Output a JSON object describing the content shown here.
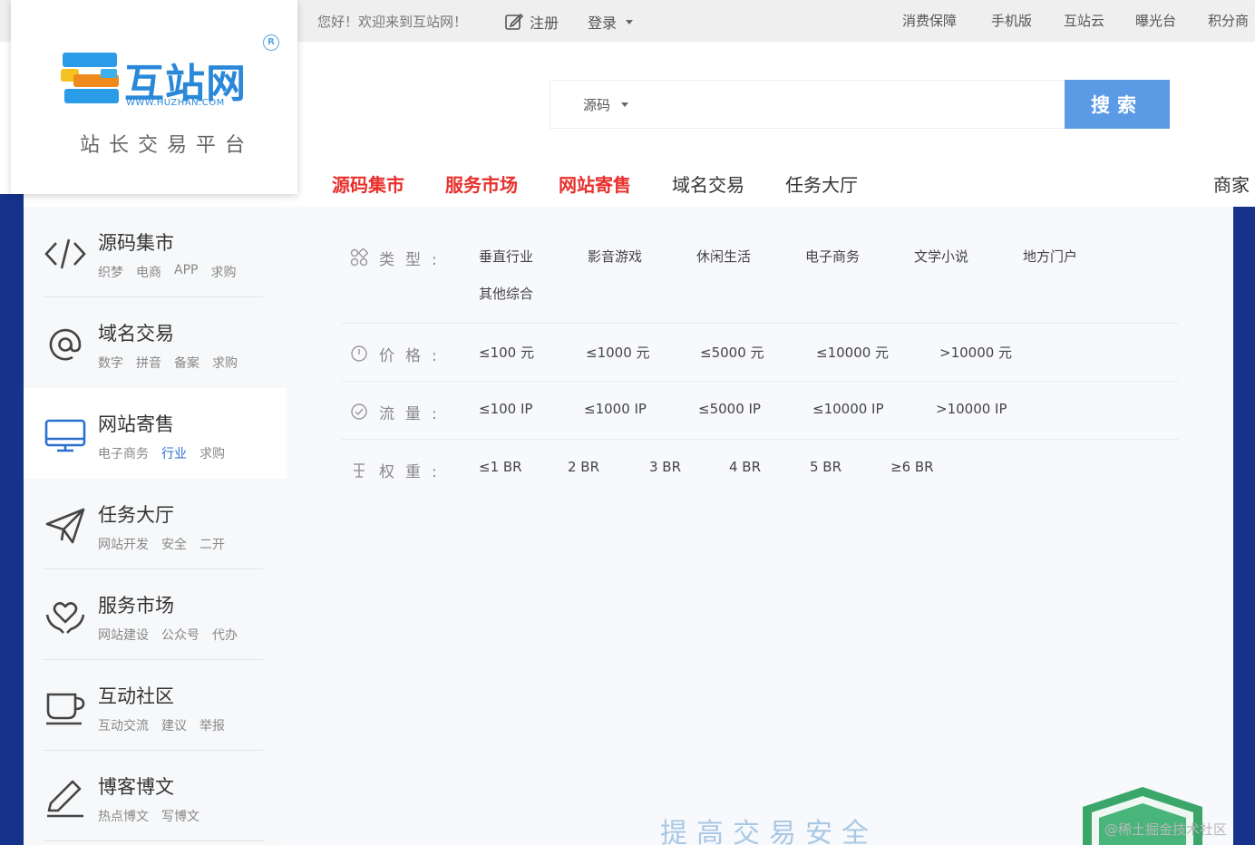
{
  "topbar": {
    "welcome": "您好！欢迎来到互站网！",
    "register": "注册",
    "login": "登录",
    "right_links": [
      "消费保障",
      "手机版",
      "互站云",
      "曝光台",
      "积分商"
    ]
  },
  "logo": {
    "name": "互站网",
    "url": "WWW.HUZHAN.COM",
    "slogan": "站长交易平台",
    "registered": "R"
  },
  "search": {
    "category": "源码",
    "placeholder": "",
    "button": "搜索"
  },
  "main_nav": {
    "items": [
      {
        "label": "源码集市",
        "hot": true
      },
      {
        "label": "服务市场",
        "hot": true
      },
      {
        "label": "网站寄售",
        "hot": true
      },
      {
        "label": "域名交易",
        "hot": false
      },
      {
        "label": "任务大厅",
        "hot": false
      }
    ],
    "merchant": "商家"
  },
  "sidebar": {
    "items": [
      {
        "title": "源码集市",
        "subs": [
          "织梦",
          "电商",
          "APP",
          "求购"
        ],
        "icon": "code-icon"
      },
      {
        "title": "域名交易",
        "subs": [
          "数字",
          "拼音",
          "备案",
          "求购"
        ],
        "icon": "at-icon"
      },
      {
        "title": "网站寄售",
        "subs": [
          "电子商务",
          "行业",
          "求购"
        ],
        "icon": "monitor-icon"
      },
      {
        "title": "任务大厅",
        "subs": [
          "网站开发",
          "安全",
          "二开"
        ],
        "icon": "paper-plane-icon"
      },
      {
        "title": "服务市场",
        "subs": [
          "网站建设",
          "公众号",
          "代办"
        ],
        "icon": "heart-hands-icon"
      },
      {
        "title": "互动社区",
        "subs": [
          "互动交流",
          "建议",
          "举报"
        ],
        "icon": "cup-icon"
      },
      {
        "title": "博客博文",
        "subs": [
          "热点博文",
          "写博文"
        ],
        "icon": "pen-icon"
      }
    ]
  },
  "filters": {
    "type": {
      "label": "类型:",
      "options": [
        "垂直行业",
        "影音游戏",
        "休闲生活",
        "电子商务",
        "文学小说",
        "地方门户",
        "其他综合"
      ]
    },
    "price": {
      "label": "价格:",
      "options": [
        "≤100 元",
        "≤1000 元",
        "≤5000 元",
        "≤10000 元",
        ">10000 元"
      ]
    },
    "traffic": {
      "label": "流量:",
      "options": [
        "≤100 IP",
        "≤1000 IP",
        "≤5000 IP",
        "≤10000 IP",
        ">10000 IP"
      ]
    },
    "weight": {
      "label": "权重:",
      "options": [
        "≤1 BR",
        "2 BR",
        "3 BR",
        "4 BR",
        "5 BR",
        "≥6 BR"
      ]
    }
  },
  "footer": {
    "slogan": "提高交易安全",
    "watermark": "@稀土掘金技术社区"
  },
  "colors": {
    "accent_red": "#e8302c",
    "brand_blue": "#2a88d8",
    "search_button": "#5b9ae4",
    "band_blue": "#16328a"
  }
}
